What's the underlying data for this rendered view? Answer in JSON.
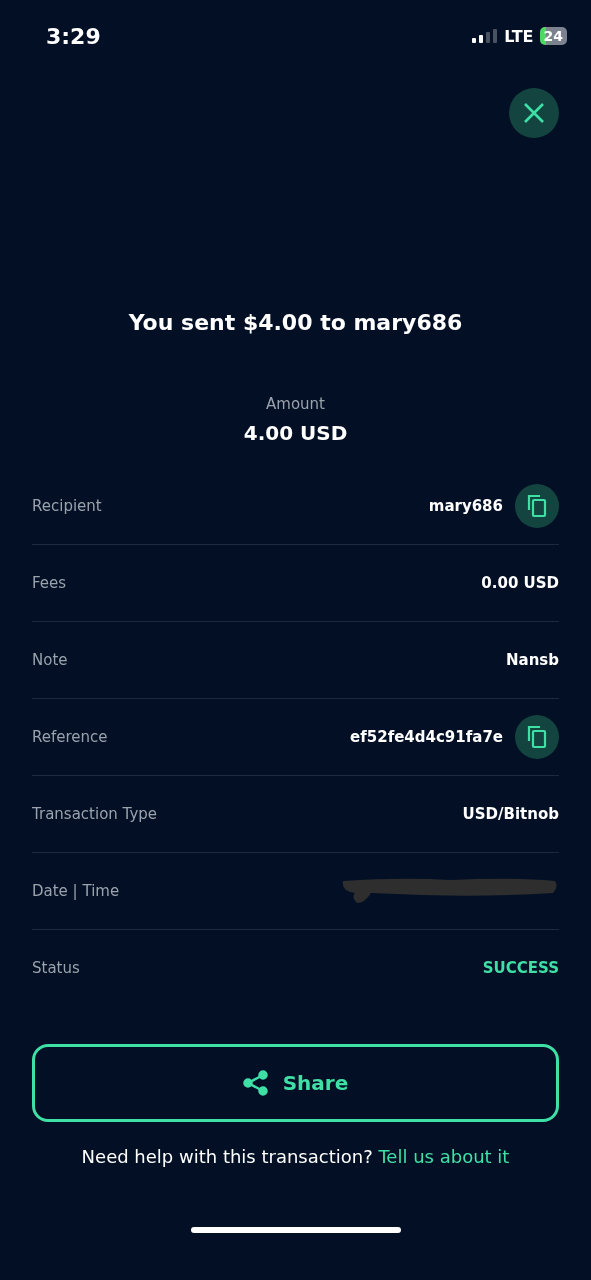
{
  "status_bar": {
    "time": "3:29",
    "network": "LTE",
    "battery": "24"
  },
  "title": "You sent $4.00 to mary686",
  "amount": {
    "label": "Amount",
    "value": "4.00 USD"
  },
  "rows": [
    {
      "kind": "copy",
      "label": "Recipient",
      "value": "mary686"
    },
    {
      "kind": "text",
      "label": "Fees",
      "value": "0.00 USD"
    },
    {
      "kind": "text",
      "label": "Note",
      "value": "Nansb"
    },
    {
      "kind": "copy",
      "label": "Reference",
      "value": "ef52fe4d4c91fa7e"
    },
    {
      "kind": "text",
      "label": "Transaction Type",
      "value": "USD/Bitnob"
    },
    {
      "kind": "redacted",
      "label": "Date | Time"
    },
    {
      "kind": "status",
      "label": "Status",
      "value": "SUCCESS"
    }
  ],
  "share_button": "Share",
  "help": {
    "text": "Need help with this transaction?",
    "link": "Tell us about it"
  }
}
